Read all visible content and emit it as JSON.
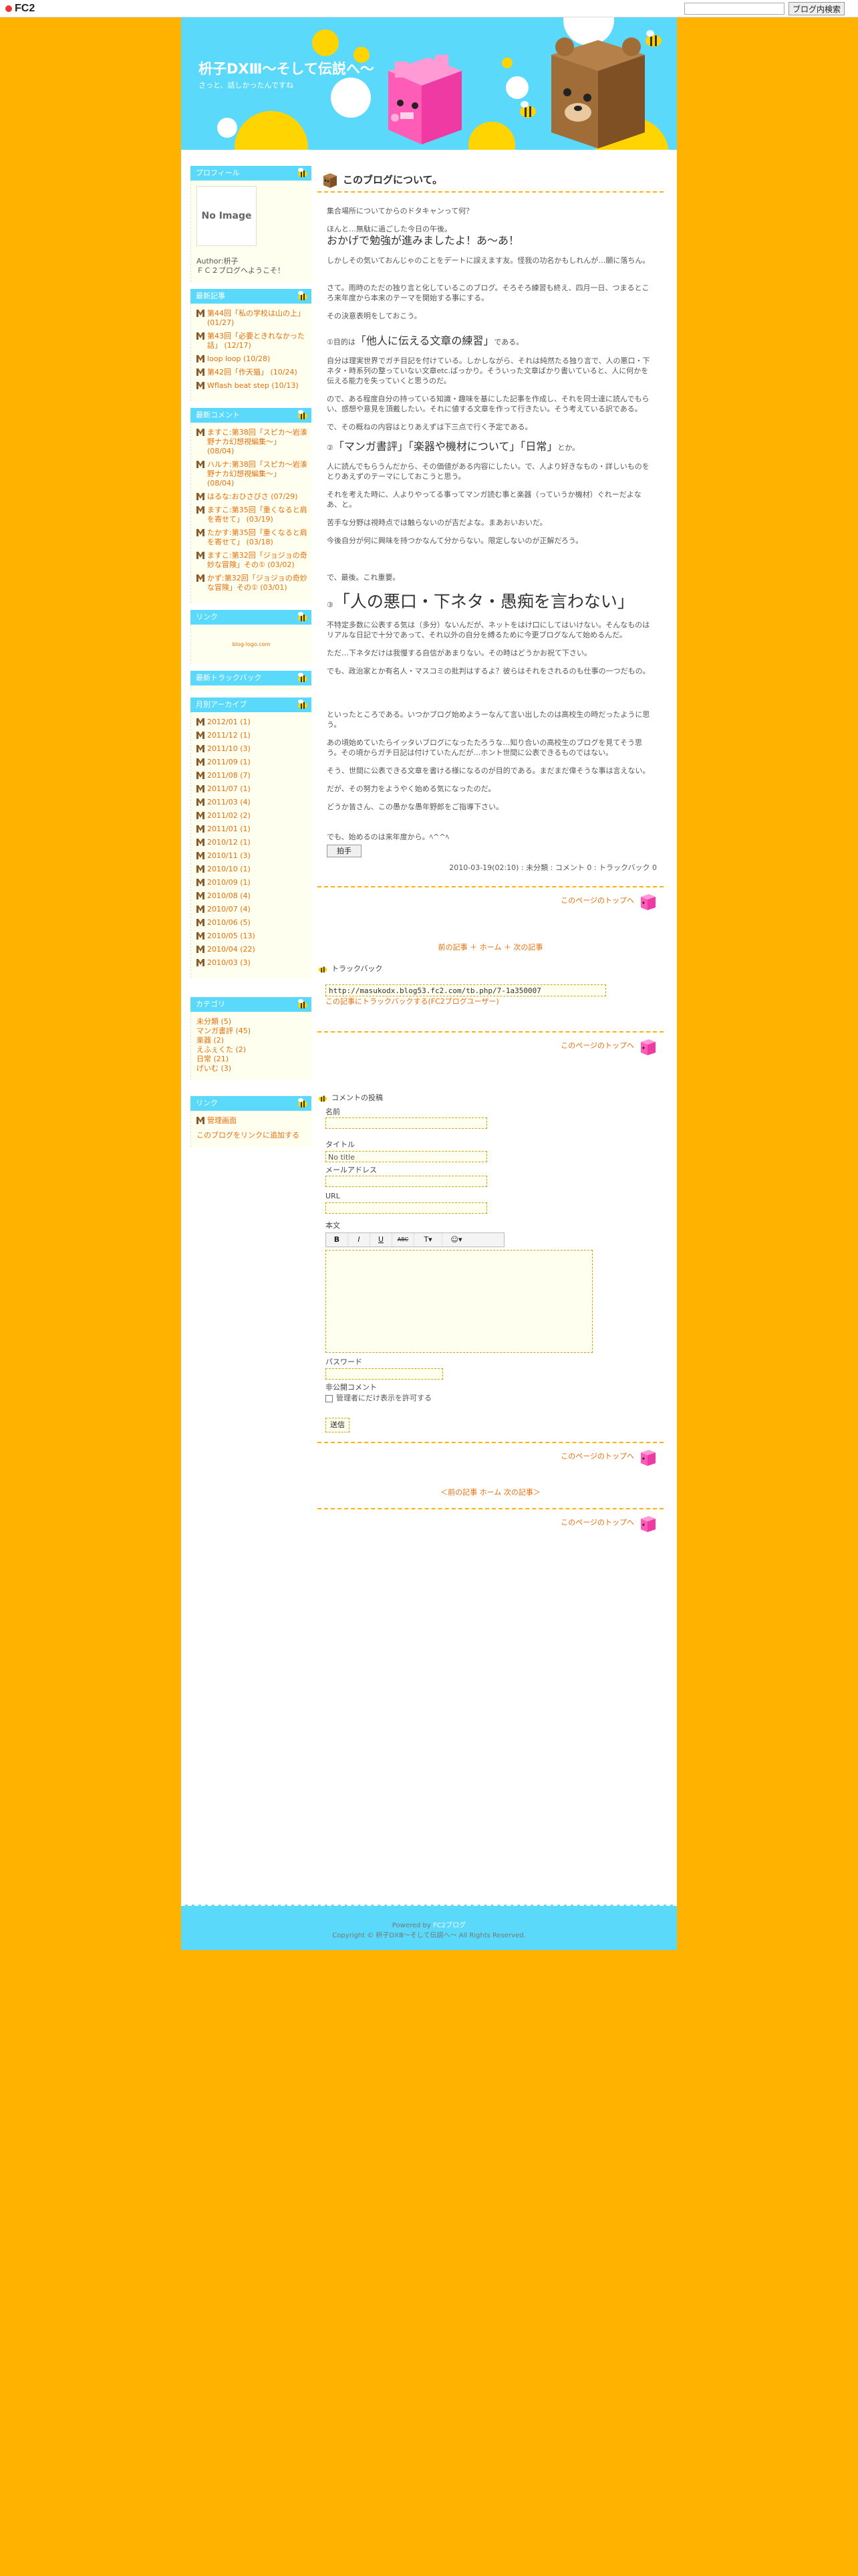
{
  "fc2": {
    "logo": "FC2",
    "search_button": "ブログ内検索",
    "search_value": ""
  },
  "blog": {
    "title": "枡子DXⅢ～そして伝説へ～",
    "description": "さっと、話しかったんですね"
  },
  "sidebar": {
    "profile": {
      "title": "プロフィール",
      "no_image": "No Image",
      "author": "Author:枡子",
      "welcome": "ＦＣ２ブログへようこそ！"
    },
    "recent_entries": {
      "title": "最新記事",
      "items": [
        "第44回「私の学校は山の上」 (01/27)",
        "第43回「必要ときれなかった話」 (12/17)",
        "loop loop (10/28)",
        "第42回「作天猫」 (10/24)",
        "Wflash beat step (10/13)"
      ]
    },
    "recent_comments": {
      "title": "最新コメント",
      "items": [
        "ますこ:第38回「スピカ～岩湊野ナカ幻想視編集～」 (08/04)",
        "ハルナ:第38回「スピカ～岩湊野ナカ幻想視編集～」 (08/04)",
        "はるな:おひさびさ (07/29)",
        "ますこ:第35回「重くなると肩を寄せて」 (03/19)",
        "たかす:第35回「重くなると肩を寄せて」 (03/18)",
        "ますこ:第32回「ジョジョの奇妙な冒険」その① (03/02)",
        "かず:第32回「ジョジョの奇妙な冒険」その① (03/01)"
      ]
    },
    "links_image": {
      "title": "リンク",
      "text": "blog-logo.com"
    },
    "recent_trackbacks": {
      "title": "最新トラックバック"
    },
    "archives": {
      "title": "月別アーカイブ",
      "items": [
        "2012/01 (1)",
        "2011/12 (1)",
        "2011/10 (3)",
        "2011/09 (1)",
        "2011/08 (7)",
        "2011/07 (1)",
        "2011/03 (4)",
        "2011/02 (2)",
        "2011/01 (1)",
        "2010/12 (1)",
        "2010/11 (3)",
        "2010/10 (1)",
        "2010/09 (1)",
        "2010/08 (4)",
        "2010/07 (4)",
        "2010/06 (5)",
        "2010/05 (13)",
        "2010/04 (22)",
        "2010/03 (3)"
      ]
    },
    "categories": {
      "title": "カテゴリ",
      "items": [
        "未分類 (5)",
        "マンガ書評 (45)",
        "楽器 (2)",
        "えふぇくた (2)",
        "日常 (21)",
        "げいむ (3)"
      ]
    },
    "links": {
      "title": "リンク",
      "items": [
        "管理画面",
        "このブログをリンクに追加する"
      ]
    }
  },
  "entry": {
    "title": "このブログについて。",
    "paragraphs": [
      "集合場所についてからのドタキャンって何？",
      "ほんと…無駄に過ごした今日の午後。",
      "しかしその気いておんじゃのことをデートに誤えます友。怪我の功名かもしれんが…願に落ちん。",
      "さて。雨時のただの独り言と化しているこのブログ。そろそろ練習も終え、四月一日、つまるところ来年度から本来のテーマを開始する事にする。",
      "その決意表明をしておこう。",
      "自分は理実世界でガチ目記を付けている。しかしながら、それは純然たる独り言で、人の悪口・下ネタ・時系列の整っていない文章etc.ばっかり。そういった文章ばかり書いていると、人に何かを伝える能力を失っていくと思うのだ。",
      "ので、ある程度自分の持っている知識・趣味を基にした記事を作成し、それを同士達に読んでもらい、感想や意見を頂戴したい。それに値する文章を作って行きたい。そう考えている訳である。",
      "で、その概ねの内容はとりあえずは下三点で行く予定である。",
      "人に読んでもらうんだから、その価値がある内容にしたい。で、人より好きなもの・詳しいものをとりあえずのテーマにしておこうと思う。",
      "それを考えた時に、人よりやってる事ってマンガ読む事と楽器（っていうか機材）ぐれーだよなあ、と。",
      "苦手な分野は視時点では触らないのが吉だよな。まあおいおいだ。",
      "今後自分が何に興味を持つかなんて分からない。限定しないのが正解だろう。",
      "で、最後。これ重要。",
      "不特定多数に公表する気は（多分）ないんだが、ネットをはけ口にしてはいけない。そんなものはリアルな日記で十分であって、それ以外の自分を縛るために今更ブログなんて始めるんだ。",
      "ただ…下ネタだけは我慢する自信があまりない。その時はどうかお祝て下さい。",
      "でも、政治家とか有名人・マスコミの批判はするよ？彼らはそれをされるのも仕事の一つだもの。",
      "といったところである。いつかブログ始めようーなんて言い出したのは高校生の時だったように思う。",
      "あの頃始めていたらイッタいブログになったたろうな…知り合いの高校生のブログを見てそう思う。その頃からガチ日記は付けていたんだが…ホント世間に公表できるものではない。",
      "そう、世間に公表できる文章を書ける様になるのが目的である。まだまだ偉そうな事は言えない。",
      "だが、その努力をようやく始める気になったのだ。",
      "どうか皆さん、この愚かな愚年野郎をご指導下さい。",
      "でも、始めるのは来年度から。ﾍ^^ﾍ"
    ],
    "headline1": "おかげで勉強が進みましたよ！あ～あ！",
    "point1_prefix": "①目的は",
    "point1": "「他人に伝える文章の練習」",
    "point1_suffix": "である。",
    "point2_prefix": "②",
    "point2": "「マンガ書評」「楽器や機材について」「日常」",
    "point2_suffix": "とか。",
    "point3_prefix": "③",
    "point3": "「人の悪口・下ネタ・愚痴を言わない」",
    "clap_label": "拍手",
    "footer_text": "2010-03-19(02:10) : 未分類 : コメント 0 : トラックバック 0"
  },
  "page_top": "このページのトップへ",
  "nav": {
    "prev": "前の記事",
    "home": "ホーム",
    "next": "次の記事",
    "nav_top": "前の記事 ＋ ホーム ＋ 次の記事",
    "nav_bottom": "＜前の記事 ホーム 次の記事＞"
  },
  "trackback": {
    "title": "トラックバック",
    "url": "http://masukodx.blog53.fc2.com/tb.php/7-1a350007",
    "link_text": "この記事にトラックバックする(FC2ブログユーザー)"
  },
  "comment_form": {
    "title": "コメントの投稿",
    "name_label": "名前",
    "title_label": "タイトル",
    "title_value": "No title",
    "email_label": "メールアドレス",
    "url_label": "URL",
    "body_label": "本文",
    "toolbar": [
      "B",
      "I",
      "U",
      "ABC",
      "T▾",
      "☺▾"
    ],
    "password_label": "パスワード",
    "private_label": "非公開コメント",
    "private_check": "管理者にだけ表示を許可する",
    "submit": "送信"
  },
  "footer": {
    "powered": "Powered by",
    "powered_link": "FC2ブログ",
    "copyright": "Copyright © 枡子DXⅢ～そして伝説へ～ All Rights Reserved."
  },
  "colors": {
    "background": "#ffb300",
    "header": "#5ad9fa",
    "link": "#e76e0b"
  }
}
